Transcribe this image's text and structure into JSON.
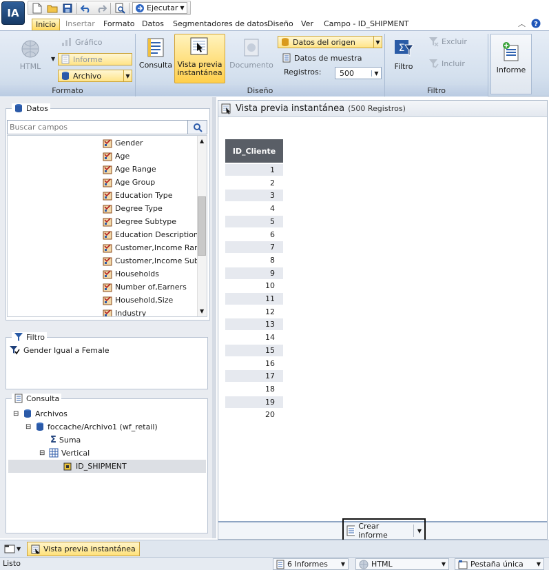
{
  "app": {
    "logo_text": "IA"
  },
  "quick_access": {
    "run_label": "Ejecutar"
  },
  "tabs": [
    {
      "label": "Inicio"
    },
    {
      "label": "Insertar"
    },
    {
      "label": "Formato"
    },
    {
      "label": "Datos"
    },
    {
      "label": "Segmentadores de datos"
    },
    {
      "label": "Diseño"
    },
    {
      "label": "Ver"
    },
    {
      "label": "Campo - ID_SHIPMENT"
    }
  ],
  "ribbon": {
    "formato": {
      "group_label": "Formato",
      "html_label": "HTML",
      "grafico_label": "Gráfico",
      "informe_label": "Informe",
      "archivo_label": "Archivo"
    },
    "diseno": {
      "group_label": "Diseño",
      "consulta_label": "Consulta",
      "vista_label_1": "Vista previa",
      "vista_label_2": "instantánea",
      "documento_label": "Documento",
      "origen_label": "Datos del origen",
      "muestra_label": "Datos de muestra",
      "registros_label": "Registros:",
      "registros_value": "500"
    },
    "filtro": {
      "group_label": "Filtro",
      "filtro_label": "Filtro",
      "excluir_label": "Excluir",
      "incluir_label": "Incluir"
    },
    "informe_label": "Informe"
  },
  "datos_pane": {
    "title": "Datos",
    "search_placeholder": "Buscar campos",
    "fields": [
      "Gender",
      "Age",
      "Age Range",
      "Age Group",
      "Education Type",
      "Degree Type",
      "Degree Subtype",
      "Education Description",
      "Customer,Income Range",
      "Customer,Income Subra",
      "Households",
      "Number of,Earners",
      "Household,Size",
      "Industry"
    ]
  },
  "filtro_pane": {
    "title": "Filtro",
    "condition": "Gender Igual a Female"
  },
  "consulta_pane": {
    "title": "Consulta",
    "tree": {
      "archivos": "Archivos",
      "source": "foccache/Archivo1 (wf_retail)",
      "suma": "Suma",
      "vertical": "Vertical",
      "field": "ID_SHIPMENT"
    }
  },
  "preview": {
    "title": "Vista previa instantánea",
    "subtitle": "(500 Registros)",
    "column_header": "ID_Cliente",
    "rows": [
      "1",
      "2",
      "3",
      "4",
      "5",
      "6",
      "7",
      "8",
      "9",
      "10",
      "11",
      "12",
      "13",
      "14",
      "15",
      "16",
      "17",
      "18",
      "19",
      "20"
    ],
    "crear_label": "Crear informe"
  },
  "doc_tab": {
    "label": "Vista previa instantánea"
  },
  "status": {
    "left": "Listo",
    "informes": "6 Informes",
    "format": "HTML",
    "pestana": "Pestaña única"
  },
  "colors": {
    "ribbon_bg": "#d4e0ee",
    "highlight": "#ffcf4b",
    "table_header": "#595e66"
  }
}
